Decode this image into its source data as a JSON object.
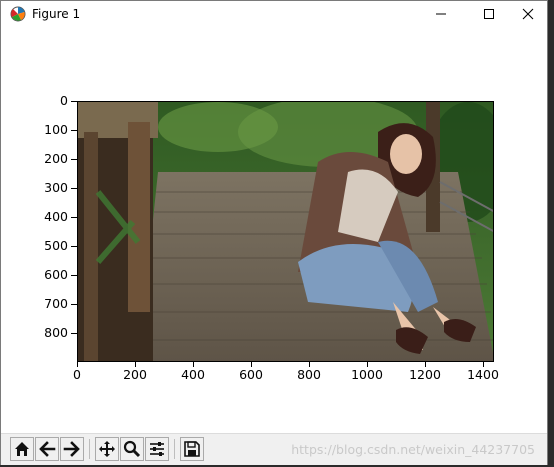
{
  "window": {
    "title": "Figure 1",
    "controls": {
      "minimize_icon": "minimize-icon",
      "maximize_icon": "maximize-icon",
      "close_icon": "close-icon"
    }
  },
  "figure": {
    "y_tick_labels": [
      "0",
      "100",
      "200",
      "300",
      "400",
      "500",
      "600",
      "700",
      "800"
    ],
    "x_tick_labels": [
      "0",
      "200",
      "400",
      "600",
      "800",
      "1000",
      "1200",
      "1400"
    ]
  },
  "toolbar": {
    "buttons": [
      {
        "icon": "home-icon"
      },
      {
        "icon": "back-arrow-icon"
      },
      {
        "icon": "forward-arrow-icon"
      },
      {
        "icon": "pan-icon"
      },
      {
        "icon": "zoom-icon"
      },
      {
        "icon": "configure-subplots-icon"
      },
      {
        "icon": "save-icon"
      }
    ],
    "watermark": "https://blog.csdn.net/weixin_44237705"
  },
  "colors": {
    "window_bg": "#ffffff",
    "toolbar_bg": "#f0f0f0",
    "wood": "#8b7a66",
    "foliage": "#3c6a2b"
  }
}
